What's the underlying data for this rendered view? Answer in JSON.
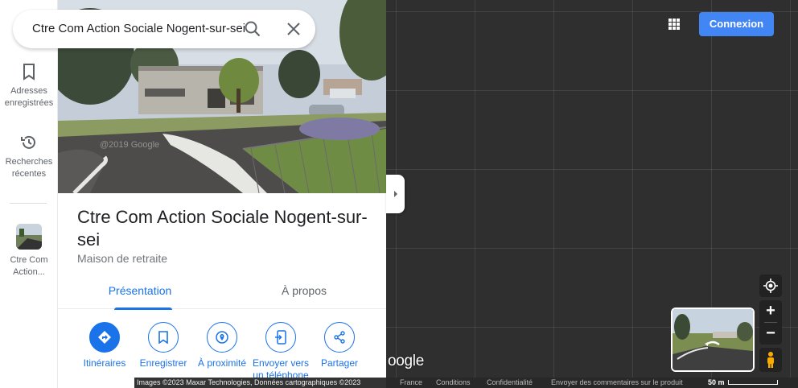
{
  "search": {
    "query": "Ctre Com Action Sociale Nogent-sur-sei",
    "search_icon": "search-icon",
    "clear_icon": "close-icon"
  },
  "rail": {
    "saved": {
      "label_line1": "Adresses",
      "label_line2": "enregistrées",
      "icon": "bookmark-icon"
    },
    "recent": {
      "label_line1": "Recherches",
      "label_line2": "récentes",
      "icon": "history-icon"
    },
    "place": {
      "label_line1": "Ctre Com",
      "label_line2": "Action..."
    }
  },
  "place": {
    "title": "Ctre Com Action Sociale Nogent-sur-sei",
    "category": "Maison de retraite",
    "photo_watermark": "@2019 Google"
  },
  "tabs": [
    {
      "label": "Présentation",
      "active": true
    },
    {
      "label": "À propos",
      "active": false
    }
  ],
  "actions": [
    {
      "label": "Itinéraires",
      "icon": "directions-icon"
    },
    {
      "label": "Enregistrer",
      "icon": "bookmark-icon"
    },
    {
      "label": "À proximité",
      "icon": "nearby-icon"
    },
    {
      "label_line1": "Envoyer vers",
      "label_line2": "un téléphone",
      "icon": "send-to-phone-icon"
    },
    {
      "label": "Partager",
      "icon": "share-icon"
    }
  ],
  "header": {
    "signin_label": "Connexion",
    "apps_icon": "apps-grid-icon"
  },
  "map": {
    "logo_text": "oogle",
    "zoom_in": "+",
    "zoom_out": "−"
  },
  "footer": {
    "credits": "Images ©2023 Maxar Technologies, Données cartographiques ©2023",
    "country": "France",
    "terms": "Conditions",
    "privacy": "Confidentialité",
    "feedback": "Envoyer des commentaires sur le produit",
    "scale": "50 m"
  },
  "colors": {
    "accent": "#1a73e8",
    "signin": "#4285f4",
    "map_bg": "#2f2f2f"
  }
}
